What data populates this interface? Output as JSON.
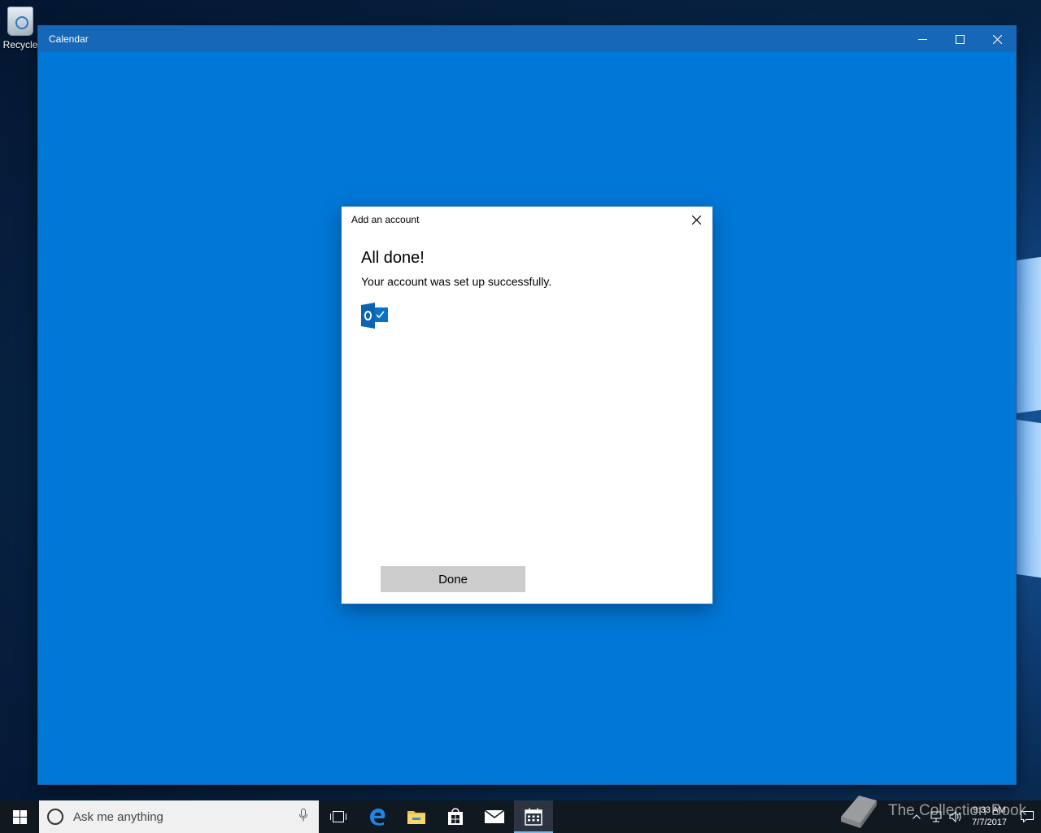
{
  "desktop": {
    "recycle_bin_label": "Recycle"
  },
  "window": {
    "title": "Calendar",
    "controls": [
      "minimize-icon",
      "maximize-icon",
      "close-icon"
    ]
  },
  "dialog": {
    "title": "Add an account",
    "heading": "All done!",
    "message": "Your account was set up successfully.",
    "account_icon": "outlook-icon",
    "done_label": "Done"
  },
  "taskbar": {
    "search_placeholder": "Ask me anything",
    "items": [
      "task-view-icon",
      "edge-icon",
      "file-explorer-icon",
      "store-icon",
      "mail-icon",
      "calendar-icon"
    ],
    "active_item": "calendar-icon",
    "clock_time": "9:33 AM",
    "clock_date": "7/7/2017"
  },
  "watermark": {
    "text": "The Collection Book"
  },
  "colors": {
    "app_background": "#0078d7",
    "titlebar": "#1767b8",
    "button_gray": "#cccccc",
    "taskbar": "#101820"
  }
}
